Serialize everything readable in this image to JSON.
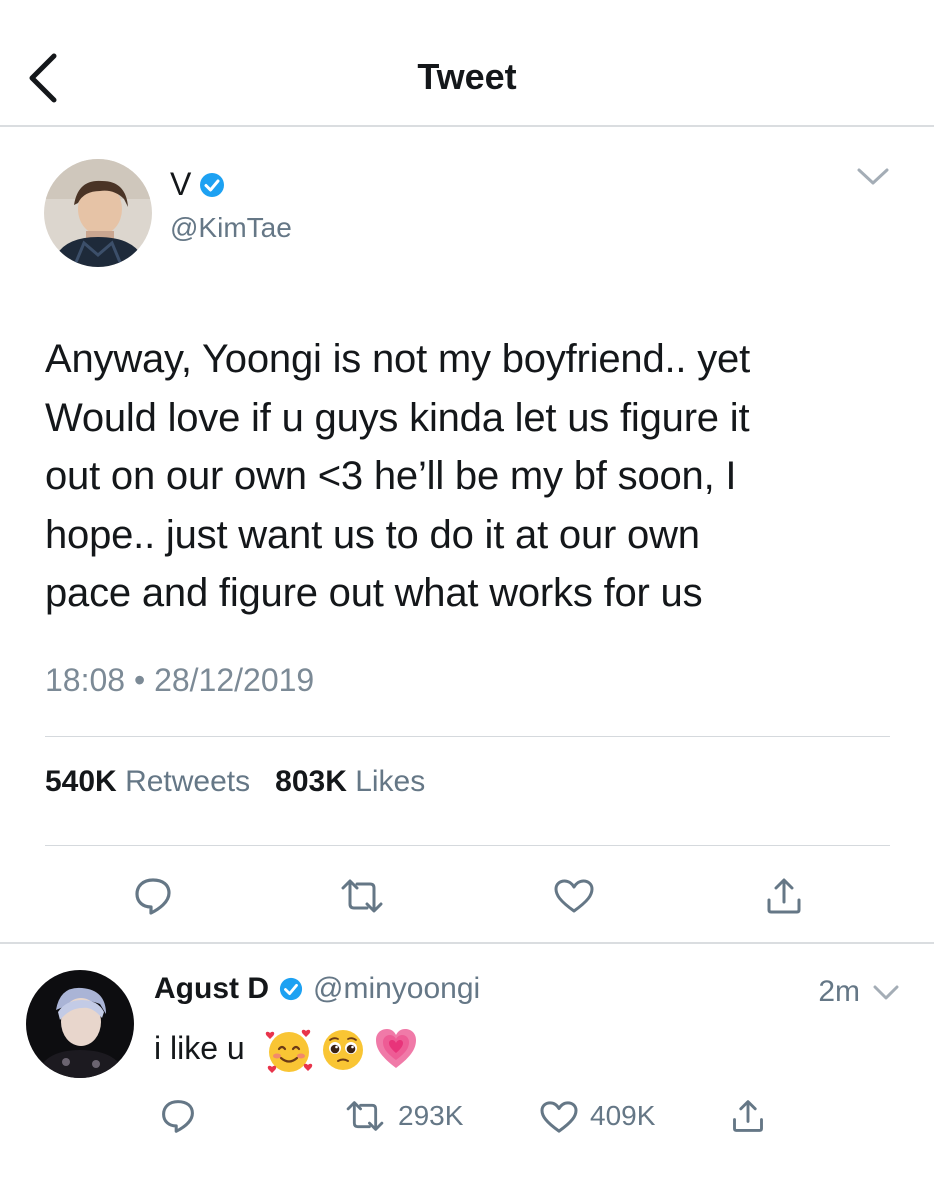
{
  "header": {
    "title": "Tweet"
  },
  "tweet": {
    "author_name": "V",
    "author_handle": "@KimTae",
    "text": "Anyway, Yoongi is not my boyfriend.. yet\nWould love if u guys kinda let us figure it\nout on our own <3 he’ll be my bf soon, I\nhope.. just want us to do it at our own\npace and figure out what works for us",
    "timestamp": "18:08 • 28/12/2019",
    "retweets_count": "540K",
    "retweets_label": "Retweets",
    "likes_count": "803K",
    "likes_label": "Likes"
  },
  "reply": {
    "author_name": "Agust D",
    "author_handle": "@minyoongi",
    "time": "2m",
    "text": "i like u",
    "emojis": [
      "smiling-face-with-hearts",
      "pleading-face",
      "growing-heart"
    ],
    "retweets_count": "293K",
    "likes_count": "409K"
  },
  "colors": {
    "verified_blue": "#1da1f2",
    "icon_blue": "#1b95e0",
    "secondary_text": "#657786",
    "divider": "#dadde0"
  }
}
